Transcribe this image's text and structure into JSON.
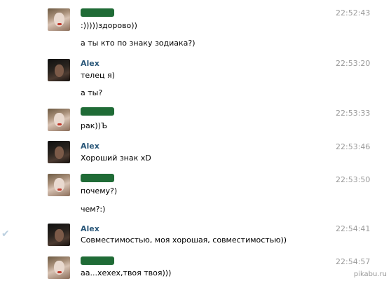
{
  "messages": [
    {
      "author": "",
      "author_hidden": true,
      "avatar": "girl",
      "time": "22:52:43",
      "lines": [
        ":)))))здорово))",
        "а ты кто по знаку зодиака?)"
      ]
    },
    {
      "author": "Alex",
      "author_hidden": false,
      "avatar": "alex",
      "time": "22:53:20",
      "lines": [
        "телец я)",
        "а ты?"
      ]
    },
    {
      "author": "",
      "author_hidden": true,
      "avatar": "girl",
      "time": "22:53:33",
      "lines": [
        "рак))Ъ"
      ]
    },
    {
      "author": "Alex",
      "author_hidden": false,
      "avatar": "alex",
      "time": "22:53:46",
      "lines": [
        "Хороший знак xD"
      ]
    },
    {
      "author": "",
      "author_hidden": true,
      "avatar": "girl",
      "time": "22:53:50",
      "lines": [
        "почему?)",
        "чем?:)"
      ]
    },
    {
      "author": "Alex",
      "author_hidden": false,
      "avatar": "alex",
      "time": "22:54:41",
      "lines": [
        "Совместимостью, моя хорошая, совместимостью))"
      ]
    },
    {
      "author": "",
      "author_hidden": true,
      "avatar": "girl",
      "time": "22:54:57",
      "lines": [
        "аа...хехех,твоя твоя)))"
      ]
    }
  ],
  "watermark": "pikabu.ru",
  "colors": {
    "author_name": "#2b587a",
    "time": "#999999",
    "redacted": "#1f6b36"
  }
}
